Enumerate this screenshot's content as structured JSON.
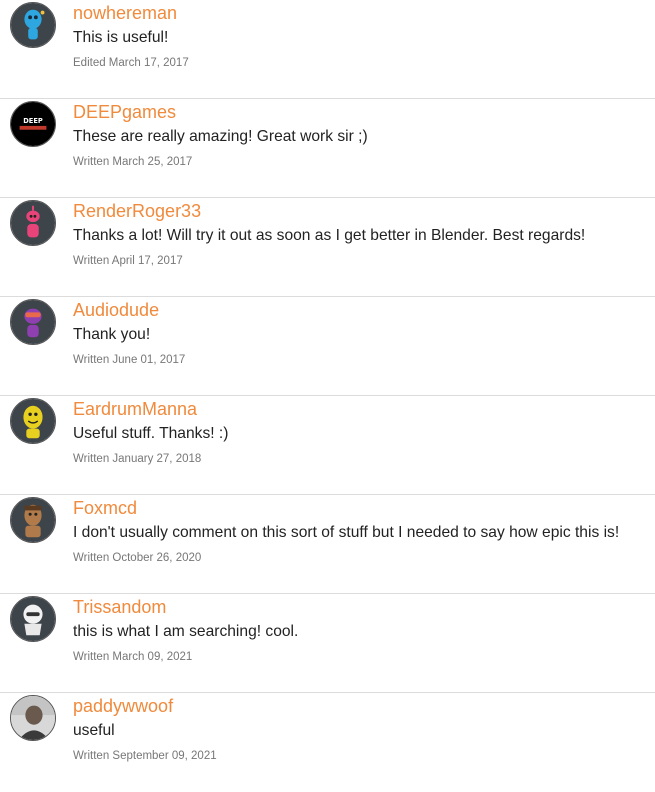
{
  "comments": [
    {
      "author": "nowhereman",
      "text": "This is useful!",
      "meta": "Edited March 17, 2017",
      "avatar": "blue-alien-avatar"
    },
    {
      "author": "DEEPgames",
      "text": "These are really amazing! Great work sir ;)",
      "meta": "Written March 25, 2017",
      "avatar": "deep-games-logo-avatar",
      "avatar_text": "DEEP"
    },
    {
      "author": "RenderRoger33",
      "text": "Thanks a lot! Will try it out as soon as I get better in Blender. Best regards!",
      "meta": "Written April 17, 2017",
      "avatar": "pink-robot-avatar"
    },
    {
      "author": "Audiodude",
      "text": "Thank you!",
      "meta": "Written June 01, 2017",
      "avatar": "purple-character-avatar"
    },
    {
      "author": "EardrumManna",
      "text": "Useful stuff. Thanks! :)",
      "meta": "Written January 27, 2018",
      "avatar": "yellow-character-avatar"
    },
    {
      "author": "Foxmcd",
      "text": "I don't usually comment on this sort of stuff but I needed to say how epic this is!",
      "meta": "Written October 26, 2020",
      "avatar": "tan-character-avatar"
    },
    {
      "author": "Trissandom",
      "text": "this is what I am searching! cool.",
      "meta": "Written March 09, 2021",
      "avatar": "white-ghost-avatar"
    },
    {
      "author": "paddywwoof",
      "text": "useful",
      "meta": "Written September 09, 2021",
      "avatar": "photo-avatar"
    }
  ],
  "colors": {
    "author": "#f08a3c",
    "text": "#222222",
    "meta": "#777777",
    "divider": "#dcdcdc"
  }
}
